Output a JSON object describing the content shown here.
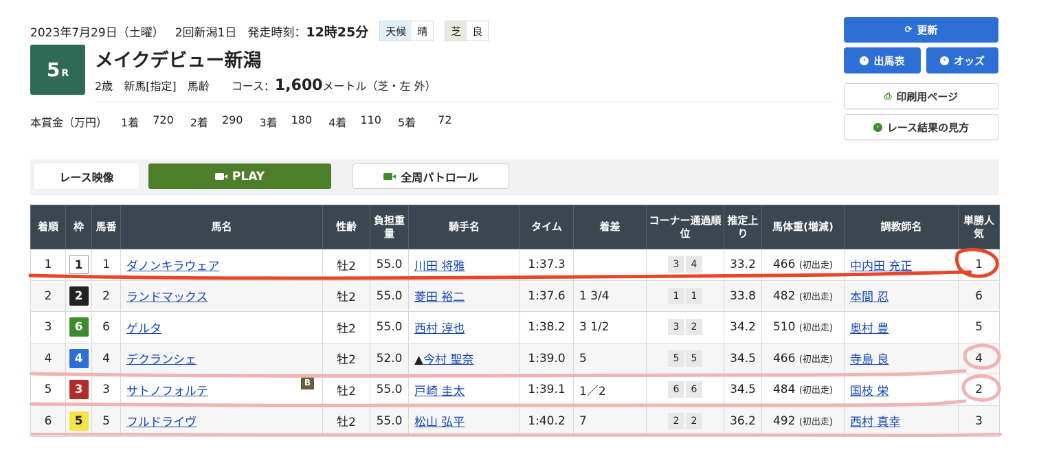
{
  "header": {
    "date": "2023年7月29日（土曜）",
    "meeting": "2回新潟1日",
    "post_time_label": "発走時刻：",
    "post_time": "12時25分",
    "weather_label": "天候",
    "weather": "晴",
    "track_label": "芝",
    "track_condition": "良"
  },
  "race": {
    "number": "5",
    "r": "R",
    "name": "メイクデビュー新潟",
    "age": "2歳",
    "class": "新馬[指定]",
    "weight_rule": "馬齢",
    "course_label": "コース：",
    "distance": "1,600",
    "distance_unit": "メートル（芝・左 外）"
  },
  "prize": {
    "label": "本賞金（万円）",
    "items": [
      {
        "place": "1着",
        "value": "720"
      },
      {
        "place": "2着",
        "value": "290"
      },
      {
        "place": "3着",
        "value": "180"
      },
      {
        "place": "4着",
        "value": "110"
      },
      {
        "place": "5着",
        "value": "72"
      }
    ]
  },
  "side_buttons": {
    "refresh": "更新",
    "entries": "出馬表",
    "odds": "オッズ",
    "print": "印刷用ページ",
    "guide": "レース結果の見方"
  },
  "video": {
    "label": "レース映像",
    "play": "PLAY",
    "patrol": "全周パトロール"
  },
  "table": {
    "headers": {
      "place": "着順",
      "waku": "枠",
      "num": "馬番",
      "horse": "馬名",
      "sexage": "性齢",
      "weight": "負担重量",
      "jockey": "騎手名",
      "time": "タイム",
      "margin": "着差",
      "corner": "コーナー通過順位",
      "last": "推定上り",
      "body": "馬体重(増減)",
      "trainer": "調教師名",
      "pop": "単勝人気"
    },
    "rows": [
      {
        "place": "1",
        "waku": "1",
        "waku_bg": "#ffffff",
        "waku_fg": "#222222",
        "num": "1",
        "horse": "ダノンキラウェア",
        "blinker": "",
        "sexage": "牡2",
        "weight": "55.0",
        "jockey": "川田 将雅",
        "jockey_mark": "",
        "time": "1:37.3",
        "margin": "",
        "c1": "3",
        "c2": "4",
        "last": "33.2",
        "body": "466",
        "body_diff": "(初出走)",
        "trainer": "中内田 充正",
        "pop": "1"
      },
      {
        "place": "2",
        "waku": "2",
        "waku_bg": "#222222",
        "waku_fg": "#ffffff",
        "num": "2",
        "horse": "ランドマックス",
        "blinker": "",
        "sexage": "牡2",
        "weight": "55.0",
        "jockey": "菱田 裕二",
        "jockey_mark": "",
        "time": "1:37.6",
        "margin": "1 3/4",
        "c1": "1",
        "c2": "1",
        "last": "33.8",
        "body": "482",
        "body_diff": "(初出走)",
        "trainer": "本間 忍",
        "pop": "6"
      },
      {
        "place": "3",
        "waku": "6",
        "waku_bg": "#3d8a2f",
        "waku_fg": "#ffffff",
        "num": "6",
        "horse": "ゲルタ",
        "blinker": "",
        "sexage": "牡2",
        "weight": "55.0",
        "jockey": "西村 淳也",
        "jockey_mark": "",
        "time": "1:38.2",
        "margin": "3 1/2",
        "c1": "3",
        "c2": "2",
        "last": "34.2",
        "body": "510",
        "body_diff": "(初出走)",
        "trainer": "奥村 豊",
        "pop": "5"
      },
      {
        "place": "4",
        "waku": "4",
        "waku_bg": "#2e6fd6",
        "waku_fg": "#ffffff",
        "num": "4",
        "horse": "デクランシェ",
        "blinker": "",
        "sexage": "牡2",
        "weight": "52.0",
        "jockey": "今村 聖奈",
        "jockey_mark": "▲",
        "time": "1:39.0",
        "margin": "5",
        "c1": "5",
        "c2": "5",
        "last": "34.5",
        "body": "466",
        "body_diff": "(初出走)",
        "trainer": "寺島 良",
        "pop": "4"
      },
      {
        "place": "5",
        "waku": "3",
        "waku_bg": "#b52a2a",
        "waku_fg": "#ffffff",
        "num": "3",
        "horse": "サトノフォルテ",
        "blinker": "B",
        "sexage": "牡2",
        "weight": "55.0",
        "jockey": "戸崎 圭太",
        "jockey_mark": "",
        "time": "1:39.1",
        "margin": "1／2",
        "c1": "6",
        "c2": "6",
        "last": "34.5",
        "body": "484",
        "body_diff": "(初出走)",
        "trainer": "国枝 栄",
        "pop": "2"
      },
      {
        "place": "6",
        "waku": "5",
        "waku_bg": "#f5e34a",
        "waku_fg": "#222222",
        "num": "5",
        "horse": "フルドライヴ",
        "blinker": "",
        "sexage": "牡2",
        "weight": "55.0",
        "jockey": "松山 弘平",
        "jockey_mark": "",
        "time": "1:40.2",
        "margin": "7",
        "c1": "2",
        "c2": "2",
        "last": "36.2",
        "body": "492",
        "body_diff": "(初出走)",
        "trainer": "西村 真幸",
        "pop": "3"
      }
    ]
  },
  "colors": {
    "annotation_red": "#e8462a",
    "annotation_pink": "#f2b3b3",
    "accent_blue": "#2e6fd6",
    "play_green": "#4d7f2a",
    "race_badge": "#2e6a55"
  }
}
